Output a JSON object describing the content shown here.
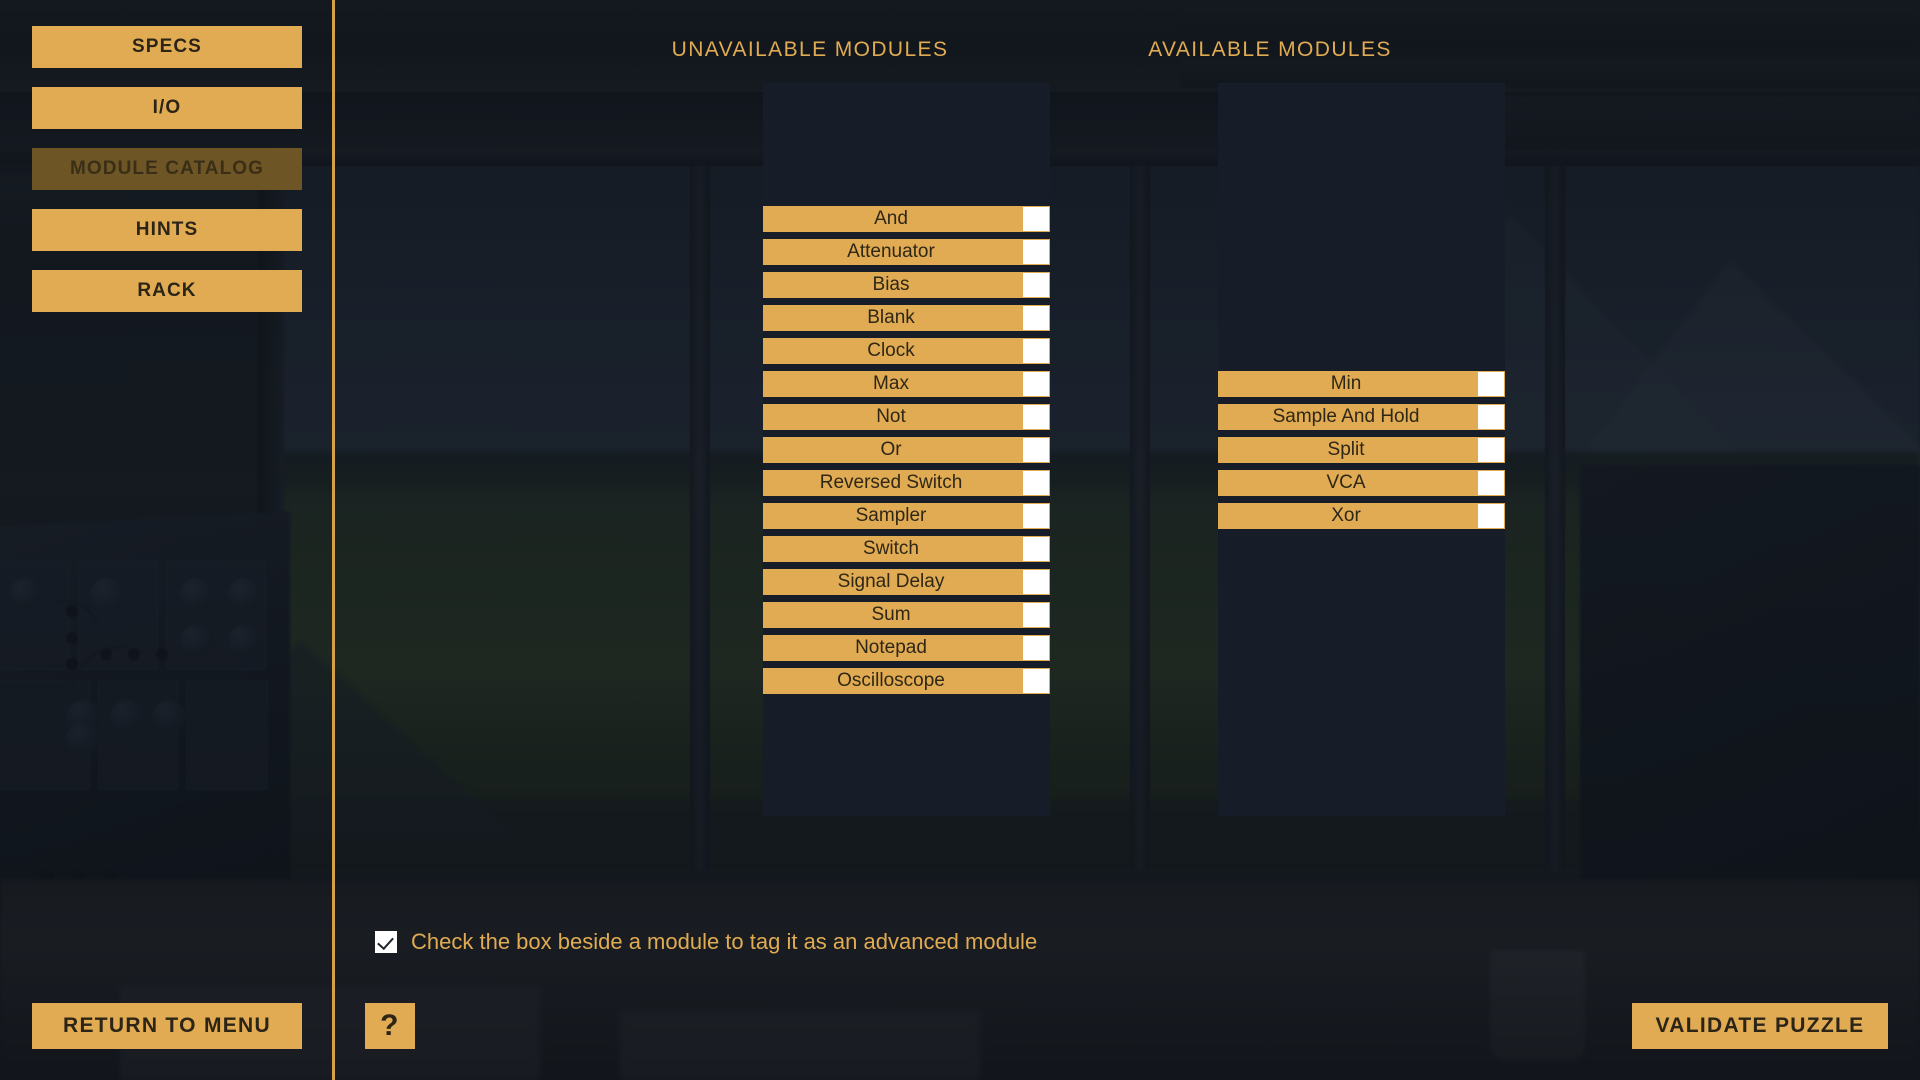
{
  "sidebar": {
    "items": [
      {
        "label": "SPECS",
        "selected": false,
        "name": "sidebar-item-specs"
      },
      {
        "label": "I/O",
        "selected": false,
        "name": "sidebar-item-io"
      },
      {
        "label": "MODULE CATALOG",
        "selected": true,
        "name": "sidebar-item-module-catalog"
      },
      {
        "label": "HINTS",
        "selected": false,
        "name": "sidebar-item-hints"
      },
      {
        "label": "RACK",
        "selected": false,
        "name": "sidebar-item-rack"
      }
    ]
  },
  "columns": {
    "unavailable": {
      "header": "UNAVAILABLE MODULES",
      "modules": [
        {
          "label": "And",
          "checked": false
        },
        {
          "label": "Attenuator",
          "checked": false
        },
        {
          "label": "Bias",
          "checked": false
        },
        {
          "label": "Blank",
          "checked": false
        },
        {
          "label": "Clock",
          "checked": false
        },
        {
          "label": "Max",
          "checked": false
        },
        {
          "label": "Not",
          "checked": false
        },
        {
          "label": "Or",
          "checked": false
        },
        {
          "label": "Reversed Switch",
          "checked": false
        },
        {
          "label": "Sampler",
          "checked": false
        },
        {
          "label": "Switch",
          "checked": false
        },
        {
          "label": "Signal Delay",
          "checked": false
        },
        {
          "label": "Sum",
          "checked": false
        },
        {
          "label": "Notepad",
          "checked": false
        },
        {
          "label": "Oscilloscope",
          "checked": false
        }
      ]
    },
    "available": {
      "header": "AVAILABLE MODULES",
      "modules": [
        {
          "label": "Min",
          "checked": false
        },
        {
          "label": "Sample And Hold",
          "checked": false
        },
        {
          "label": "Split",
          "checked": false
        },
        {
          "label": "VCA",
          "checked": false
        },
        {
          "label": "Xor",
          "checked": false
        }
      ]
    }
  },
  "hint": {
    "checked": true,
    "text": "Check the box beside a module to tag it as an advanced module"
  },
  "bottom_bar": {
    "return_label": "RETURN TO MENU",
    "help_label": "?",
    "validate_label": "VALIDATE PUZZLE"
  },
  "colors": {
    "accent": "#e0ab52",
    "accent_selected": "#6d5526",
    "panel_bg": "#161d28",
    "text_on_accent": "#2f2716",
    "checkbox": "#ffffff"
  }
}
